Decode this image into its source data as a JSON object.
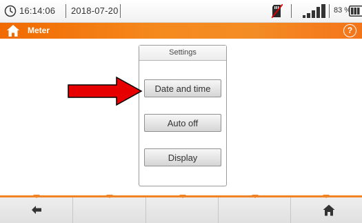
{
  "status": {
    "time": "16:14:06",
    "date": "2018-07-20",
    "battery_percent": "83 %",
    "battery_level": 0.83,
    "signal_bars": 4,
    "icons": [
      "clock-icon",
      "sd-card-icon",
      "signal-strength-icon",
      "battery-icon"
    ]
  },
  "header": {
    "title": "Meter",
    "help": "?",
    "icons": [
      "home-icon",
      "help-icon"
    ]
  },
  "panel": {
    "title": "Settings",
    "buttons": [
      {
        "label": "Date and time"
      },
      {
        "label": "Auto off"
      },
      {
        "label": "Display"
      }
    ]
  },
  "annotation": {
    "arrow_color": "#e60000",
    "points_to": "Date and time"
  },
  "footer": {
    "icons": [
      "back-arrow-icon",
      "home-icon"
    ]
  },
  "colors": {
    "accent": "#f58220",
    "header_gradient_start": "#f06a00",
    "header_gradient_end": "#f4741a"
  }
}
